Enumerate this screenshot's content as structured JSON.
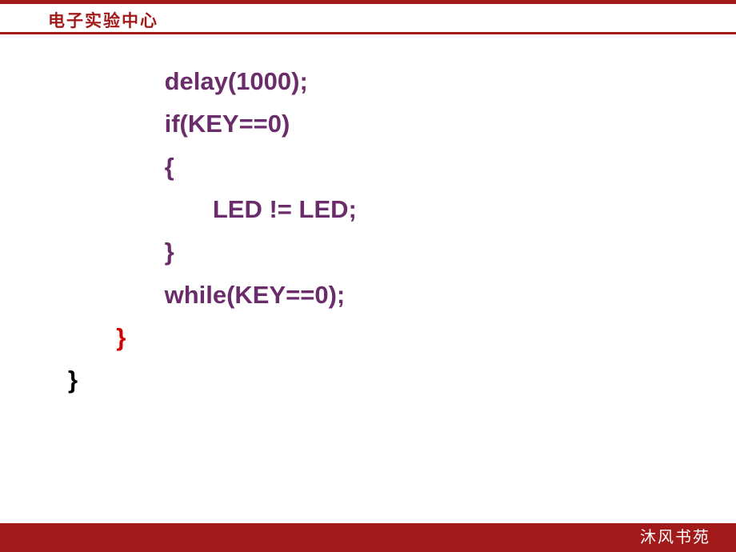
{
  "header": {
    "title": "电子实验中心"
  },
  "code": {
    "line1": "              delay(1000);",
    "line2": "              if(KEY==0)",
    "line3": "              {",
    "line4": "                     LED != LED;",
    "line5": "              }",
    "line6": "              while(KEY==0);",
    "line7": "       }",
    "line8": "}"
  },
  "footer": {
    "text": "沐风书苑"
  }
}
